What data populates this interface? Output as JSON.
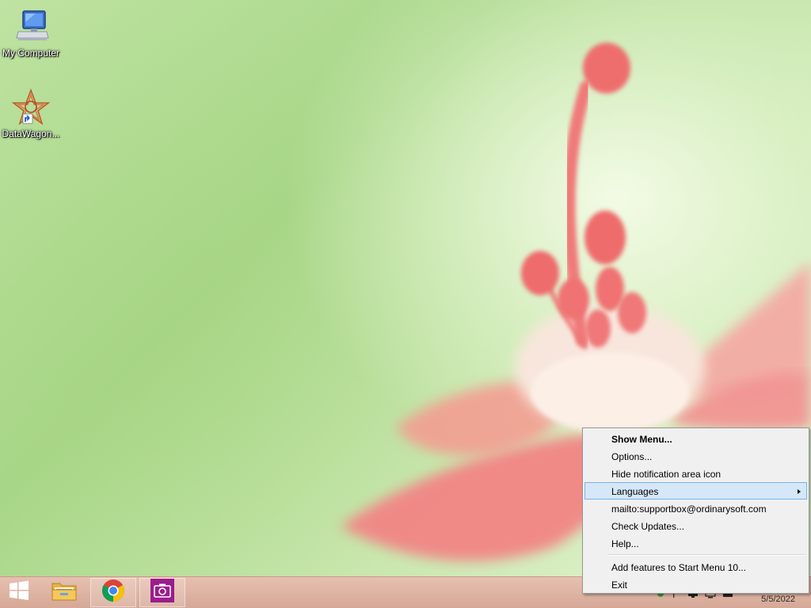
{
  "desktop": {
    "icons": [
      {
        "label": "My Computer",
        "icon": "computer-icon"
      },
      {
        "label": "DataWagon...",
        "icon": "datawagon-shortcut-icon"
      }
    ]
  },
  "taskbar": {
    "start_icon": "windows-logo-icon",
    "pinned": [
      {
        "name": "File Explorer",
        "icon": "folder-icon"
      },
      {
        "name": "Google Chrome",
        "icon": "chrome-icon"
      },
      {
        "name": "Camera",
        "icon": "camera-icon"
      }
    ],
    "tray": {
      "date": "5/5/2022"
    }
  },
  "context_menu": {
    "items": [
      {
        "label": "Show Menu...",
        "bold": true
      },
      {
        "label": "Options..."
      },
      {
        "label": "Hide notification area icon"
      },
      {
        "label": "Languages",
        "submenu": true,
        "highlighted": true
      },
      {
        "label": "mailto:supportbox@ordinarysoft.com"
      },
      {
        "label": "Check Updates..."
      },
      {
        "label": "Help..."
      },
      {
        "label": "Add features to Start Menu 10..."
      },
      {
        "label": "Exit"
      }
    ]
  },
  "colors": {
    "menu_highlight": "#d5e7f8",
    "menu_highlight_border": "#7ab3e6",
    "taskbar": "#dcb0a0",
    "camera_tile": "#9b1d8c"
  }
}
